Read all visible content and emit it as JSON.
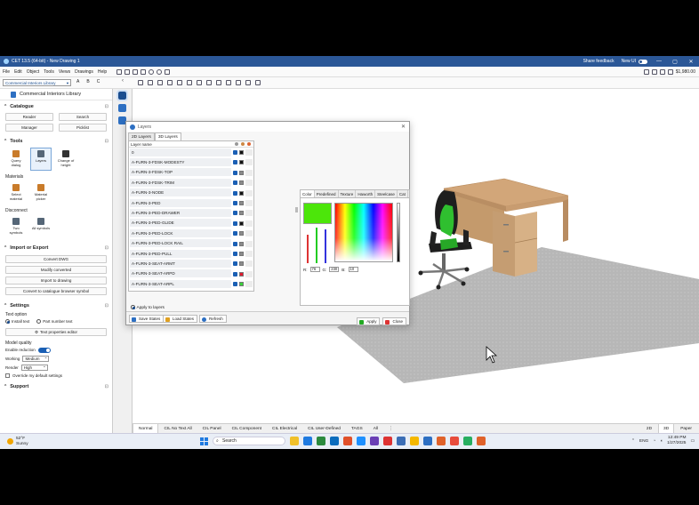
{
  "window": {
    "title": "CET 13.5 (64-bit) - New Drawing 1",
    "share_feedback": "Share feedback",
    "new_ui": "New UI",
    "min": "—",
    "max": "▢",
    "close": "✕"
  },
  "menu": [
    "File",
    "Edit",
    "Object",
    "Tools",
    "Views",
    "Drawings",
    "Help"
  ],
  "price": "$1,980.00",
  "library_select": "Commercial Interiors Library",
  "abc_tabs": [
    "A",
    "B",
    "C"
  ],
  "left_panel": {
    "library_title": "Commercial Interiors Library",
    "catalogue": {
      "title": "Catalogue",
      "buttons": [
        "Reader",
        "Search",
        "Manager",
        "Picklist"
      ]
    },
    "tools": {
      "title": "Tools",
      "items": [
        {
          "label": "Query dialog",
          "icon": "pencil-icon",
          "color": "#c97b2a"
        },
        {
          "label": "Layers",
          "icon": "layers-icon",
          "color": "#556677"
        },
        {
          "label": "Change of height",
          "icon": "height-icon",
          "color": "#333333"
        }
      ],
      "materials_label": "Materials",
      "materials": [
        {
          "label": "Select material",
          "icon": "brush-icon",
          "color": "#c97b2a"
        },
        {
          "label": "Material picker",
          "icon": "dropper-icon",
          "color": "#c97b2a"
        }
      ],
      "disconnect_label": "Disconnect",
      "disconnect": [
        {
          "label": "Two symbols",
          "icon": "two-symbols-icon",
          "color": "#556677"
        },
        {
          "label": "All symbols",
          "icon": "all-symbols-icon",
          "color": "#556677"
        }
      ]
    },
    "import_export": {
      "title": "Import or Export",
      "buttons": [
        "Convert DWG",
        "Modify converted",
        "Import to drawing",
        "Convert to catalogue browser symbol"
      ]
    },
    "settings": {
      "title": "Settings",
      "text_option_label": "Text option",
      "install_text": "Install text",
      "part_number_text": "Part number text",
      "text_props_btn": "Text properties editor",
      "model_quality_label": "Model quality",
      "enable_reduction": "Enable reduction",
      "working_label": "Working",
      "working_value": "Medium",
      "render_label": "Render",
      "render_value": "High",
      "override_label": "Override my default settings"
    },
    "support": {
      "title": "Support"
    }
  },
  "dialog": {
    "title": "Layers",
    "close": "✕",
    "tabs": [
      "2D Layers",
      "3D Layers"
    ],
    "active_tab": "3D Layers",
    "header": "Layer name",
    "layers": [
      {
        "name": "0",
        "color": "#111111"
      },
      {
        "name": "A-FURN-3-FDSK-MODESTY",
        "color": "#111111"
      },
      {
        "name": "A-FURN-3-FDSK-TOP",
        "color": "#8a8a8a"
      },
      {
        "name": "A-FURN-3-FDSK-TRIM",
        "color": "#8a8a8a"
      },
      {
        "name": "A-FURN-3-NODE",
        "color": "#111111"
      },
      {
        "name": "A-FURN-3-PED",
        "color": "#8a8a8a"
      },
      {
        "name": "A-FURN-3-PED-DRAWER",
        "color": "#8a8a8a"
      },
      {
        "name": "A-FURN-3-PED-GLIDE",
        "color": "#111111"
      },
      {
        "name": "A-FURN-3-PED-LOCK",
        "color": "#8a8a8a"
      },
      {
        "name": "A-FURN-3-PED-LOCK RAIL",
        "color": "#8a8a8a"
      },
      {
        "name": "A-FURN-3-PED-PULL",
        "color": "#8a8a8a"
      },
      {
        "name": "A-FURN-3-SEAT-ARMT",
        "color": "#8a8a8a"
      },
      {
        "name": "A-FURN-3-SEAT-ARPD",
        "color": "#e0192d"
      },
      {
        "name": "A-FURN-3-SEAT-ARPL",
        "color": "#3ad23a"
      }
    ],
    "apply_to_layers": "Apply to layers",
    "apply_to_group": "Apply to selected group",
    "save_states": "Save States",
    "load_states": "Load States",
    "refresh": "Refresh",
    "apply": "Apply",
    "close_btn": "Close",
    "color_tabs": [
      "Color",
      "Predefined",
      "Texture",
      "Haworth",
      "Steelcase",
      "Cat"
    ],
    "current_color": "#4ce60a",
    "r": "76",
    "g": "230",
    "b": "10",
    "r_label": "R:",
    "g_label": "G:",
    "b_label": "B:"
  },
  "bottom_tabs": [
    "Normal",
    "CIL No Text All",
    "CIL Panel",
    "CIL Component",
    "CIL Electrical",
    "CIL User-Defined",
    "TAGS",
    "All",
    "⋮"
  ],
  "view_tabs": [
    "2D",
    "3D",
    "Paper"
  ],
  "taskbar": {
    "temp": "52°F",
    "weather": "Sunny",
    "search": "Search",
    "lang": "ENG",
    "time": "12:49 PM",
    "date": "1/27/2025",
    "app_colors": [
      "#f0c02a",
      "#1f7ae0",
      "#2b8a3e",
      "#0b6cbd",
      "#e0502a",
      "#1e90ff",
      "#6a3fb5",
      "#d33",
      "#3b6db5",
      "#f5b800",
      "#d03b2b",
      "#2d6fc2",
      "#e0622a",
      "#e74c3c",
      "#27ae60",
      "#e0622a"
    ]
  }
}
